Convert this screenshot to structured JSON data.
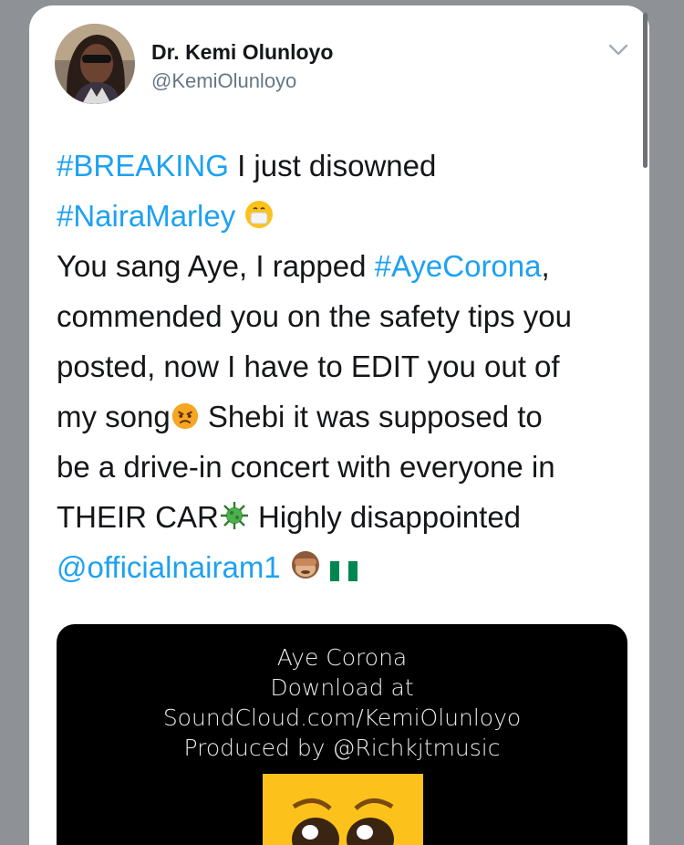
{
  "author": {
    "name": "Dr. Kemi Olunloyo",
    "handle": "@KemiOlunloyo"
  },
  "tweet": {
    "lines": [
      [
        {
          "t": "#BREAKING",
          "link": true
        },
        {
          "t": " I just disowned"
        }
      ],
      [
        {
          "t": "#NairaMarley",
          "link": true
        },
        {
          "t": " ",
          "icon": "mask-emoji"
        }
      ],
      [
        {
          "t": "You sang Aye, I rapped "
        },
        {
          "t": "#AyeCorona",
          "link": true
        },
        {
          "t": ","
        }
      ],
      [
        {
          "t": "commended you on the safety tips you"
        }
      ],
      [
        {
          "t": "posted, now I have to EDIT you out of"
        }
      ],
      [
        {
          "t": "my song",
          "icon_after": "angry-emoji"
        },
        {
          "t": " Shebi it was supposed to"
        }
      ],
      [
        {
          "t": "be a drive-in concert with everyone in"
        }
      ],
      [
        {
          "t": "THEIR CAR",
          "icon_after": "virus-emoji"
        },
        {
          "t": " Highly disappointed"
        }
      ],
      [
        {
          "t": "@officialnairam1",
          "link": true
        }
      ]
    ],
    "line_texts": [
      "#BREAKING",
      " I just disowned",
      "#NairaMarley",
      "You sang Aye, I rapped ",
      "#AyeCorona",
      ",",
      "commended you on the safety tips you",
      "posted, now I have to EDIT you out of",
      "my song",
      " Shebi it was supposed to",
      "be a drive-in concert with everyone in",
      "THEIR CAR",
      " Highly disappointed",
      "@officialnairam1"
    ]
  },
  "media": {
    "lines": [
      "Aye Corona",
      "Download at",
      "SoundCloud.com/KemiOlunloyo",
      "Produced by @Richkjtmusic"
    ]
  },
  "icons": {
    "avatar": "profile-photo",
    "menu": "chevron-down-icon",
    "emojis": [
      "mask-emoji",
      "angry-emoji",
      "virus-emoji",
      "see-no-evil-monkey-emoji",
      "nigeria-flag-emoji",
      "pleading-face-emoji"
    ]
  },
  "colors": {
    "link": "#1da1f2",
    "text": "#141619",
    "muted": "#657786",
    "background": "#8e9296"
  }
}
